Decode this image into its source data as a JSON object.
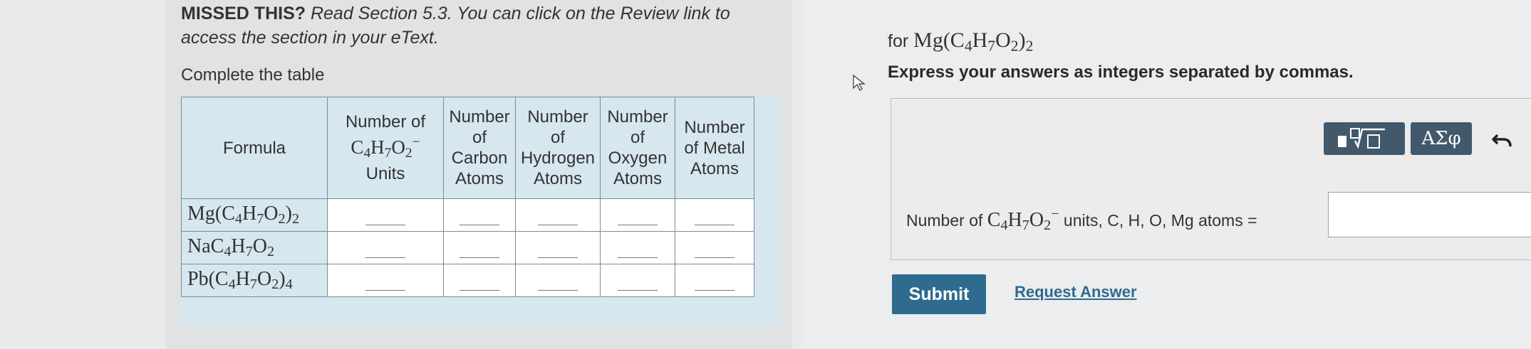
{
  "intro": {
    "missed_label": "MISSED THIS?",
    "text_line1": "Read Section 5.3. You can click on the Review link to",
    "text_line2": "access the section in your eText."
  },
  "complete_label": "Complete the table",
  "table": {
    "headers": [
      "Formula",
      "Number of C4H7O2− Units",
      "Number of Carbon Atoms",
      "Number of Hydrogen Atoms",
      "Number of Oxygen Atoms",
      "Number of Metal Atoms"
    ],
    "rows": [
      {
        "formula": "Mg(C4H7O2)2"
      },
      {
        "formula": "NaC4H7O2"
      },
      {
        "formula": "Pb(C4H7O2)4"
      }
    ]
  },
  "question": {
    "for_label": "for",
    "formula": "Mg(C4H7O2)2",
    "instruction": "Express your answers as integers separated by commas.",
    "answer_prefix": "Number of",
    "answer_ion": "C4H7O2−",
    "answer_suffix": "units, C, H, O, Mg atoms ="
  },
  "toolbar": {
    "greek_label": "ΑΣφ",
    "icons": [
      "templates-icon",
      "greek-symbols-icon",
      "undo-icon"
    ]
  },
  "actions": {
    "submit_label": "Submit",
    "request_answer_label": "Request Answer"
  },
  "colors": {
    "submit_bg": "#2f6b8f",
    "toolbar_bg": "#42586b",
    "table_header_bg": "#d6e7ef"
  }
}
